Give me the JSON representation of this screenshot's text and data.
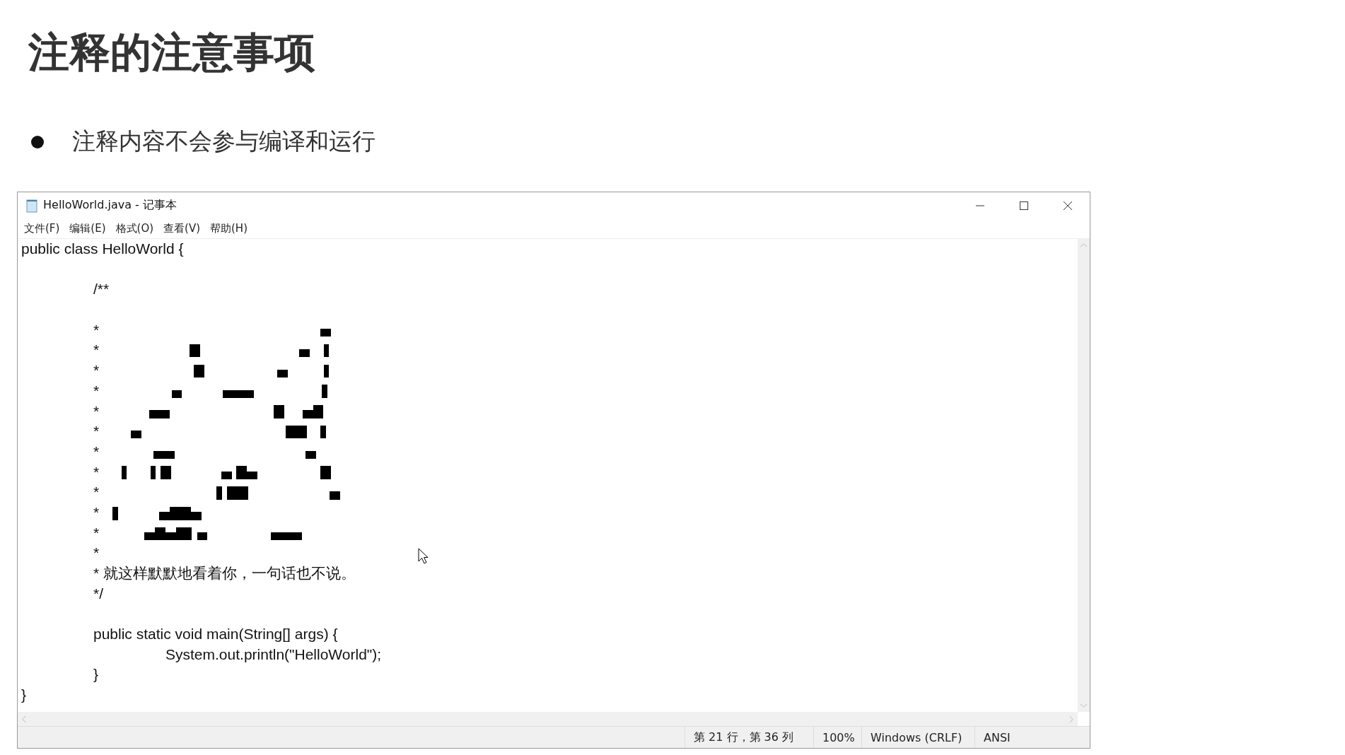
{
  "slide": {
    "title": "注释的注意事项",
    "bullets": [
      "注释内容不会参与编译和运行"
    ]
  },
  "window": {
    "title": "HelloWorld.java - 记事本",
    "menu": [
      "文件(F)",
      "编辑(E)",
      "格式(O)",
      "查看(V)",
      "帮助(H)"
    ],
    "paragraphs": [
      {
        "lines": [
          "public class HelloWorld {"
        ]
      },
      {
        "lines": [
          "\t/**"
        ]
      },
      {
        "lines": [
          "\t*",
          "\t*",
          "\t*",
          "\t*",
          "\t*",
          "\t*",
          "\t*",
          "\t*",
          "\t*",
          "\t*",
          "\t*",
          "\t*",
          "\t* 就这样默默地看着你，一句话也不说。",
          "\t*/"
        ]
      },
      {
        "lines": [
          "\tpublic static void main(String[] args) {",
          "\t\tSystem.out.println(\"HelloWorld\");",
          "\t}",
          "}"
        ]
      }
    ],
    "status_bar": [
      "第 21 行，第 36 列",
      "100%",
      "Windows (CRLF)",
      "ANSI"
    ]
  }
}
